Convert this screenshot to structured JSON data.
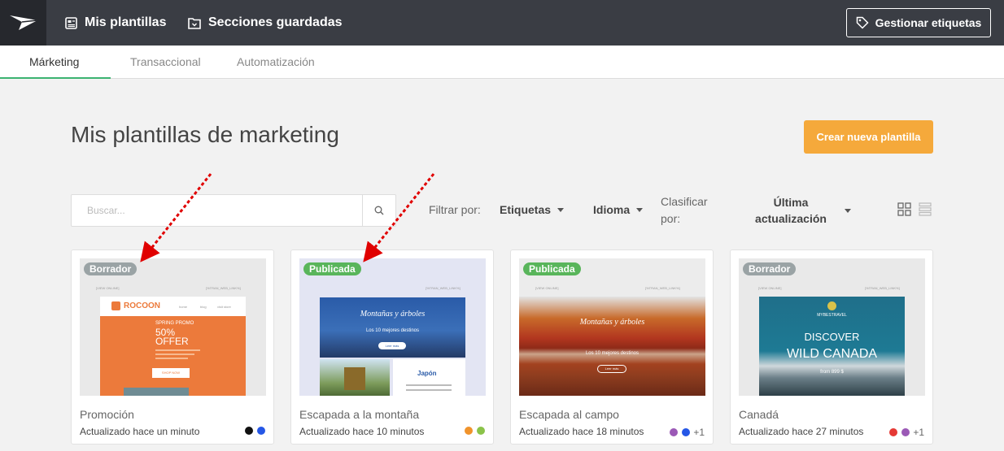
{
  "topbar": {
    "nav": [
      {
        "label": "Mis plantillas",
        "icon": "template-icon"
      },
      {
        "label": "Secciones guardadas",
        "icon": "saved-sections-icon"
      }
    ],
    "manage_tags_label": "Gestionar etiquetas"
  },
  "tabs": [
    {
      "label": "Márketing",
      "active": true
    },
    {
      "label": "Transaccional",
      "active": false
    },
    {
      "label": "Automatización",
      "active": false
    }
  ],
  "page_title": "Mis plantillas de marketing",
  "create_button": "Crear nueva plantilla",
  "search": {
    "placeholder": "Buscar..."
  },
  "filters": {
    "filter_label": "Filtrar por:",
    "tags_label": "Etiquetas",
    "language_label": "Idioma",
    "sort_label_1": "Clasificar",
    "sort_label_2": "por:",
    "sort_value_1": "Última",
    "sort_value_2": "actualización"
  },
  "cards": [
    {
      "status": "Borrador",
      "title": "Promoción",
      "updated": "Actualizado hace un minuto",
      "colors": [
        "#111111",
        "#2557e6"
      ],
      "extra": "",
      "thumb": {
        "brand": "ROCOON",
        "nav": [
          "home",
          "blog",
          "visit store"
        ],
        "promo_small": "SPRING PROMO",
        "promo_pct": "50%",
        "promo_word": "OFFER",
        "cta": "SHOP NOW",
        "view_online": "[VIEW ONLINE]",
        "webview": "[%TRAN_WEB_LINK%]"
      }
    },
    {
      "status": "Publicada",
      "title": "Escapada a la montaña",
      "updated": "Actualizado hace 10 minutos",
      "colors": [
        "#f0932b",
        "#8bc34a"
      ],
      "extra": "",
      "thumb": {
        "heading": "Montañas y árboles",
        "sub": "Los 10 mejores destinos",
        "cta": "Leer más",
        "side_title": "Japón",
        "webview": "[%TRAN_WEB_LINK%]"
      }
    },
    {
      "status": "Publicada",
      "title": "Escapada al campo",
      "updated": "Actualizado hace 18 minutos",
      "colors": [
        "#9b59b6",
        "#2557e6"
      ],
      "extra": "+1",
      "thumb": {
        "heading": "Montañas y árboles",
        "sub": "Los 10 mejores destinos",
        "cta": "Leer más",
        "view_online": "[VIEW ONLINE]",
        "webview": "[%TRAN_WEB_LINK%]"
      }
    },
    {
      "status": "Borrador",
      "title": "Canadá",
      "updated": "Actualizado hace 27 minutos",
      "colors": [
        "#e53935",
        "#9b59b6"
      ],
      "extra": "+1",
      "thumb": {
        "brand": "MYBESTRAVEL",
        "line1": "DISCOVER",
        "line2": "WILD CANADA",
        "price": "from 899 $",
        "view_online": "[VIEW ONLINE]",
        "webview": "[%TRAN_WEB_LINK%]"
      }
    }
  ],
  "colors": {
    "topbar": "#3a3d44",
    "accent_tab": "#3cb371",
    "create_button": "#f5a93b",
    "draft_badge": "#9aa3a5",
    "published_badge": "#59b55b",
    "annotation_arrow": "#e00000"
  }
}
